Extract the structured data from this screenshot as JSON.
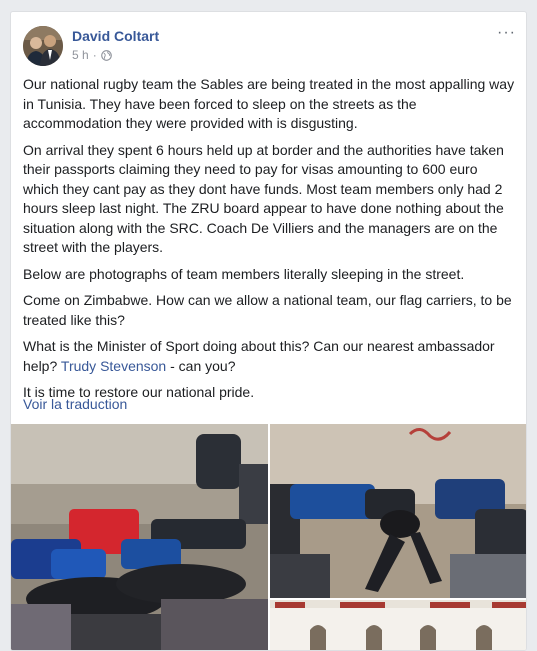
{
  "post": {
    "author": "David Coltart",
    "time": "5 h",
    "dot": "·",
    "more": "···",
    "translate": "Voir la traduction"
  },
  "paragraphs": [
    "Our national rugby team the Sables are being treated in the most appalling way in Tunisia. They have been forced to sleep on the streets as the accommodation they were provided with is disgusting.",
    "On arrival they spent 6 hours held up at border and the authorities have taken their passports claiming they need to pay for visas amounting to 600 euro which they cant pay as they dont have funds. Most team members only had 2 hours sleep last night. The ZRU board appear to have done nothing about the situation along with the SRC. Coach De Villiers and the managers are on the street with the players.",
    "Below are photographs of team members literally sleeping in the street.",
    "Come on Zimbabwe. How can we allow a national team, our flag carriers, to be treated like this?"
  ],
  "question": {
    "before": "What is the Minister of Sport doing about this? Can our nearest ambassador help? ",
    "mention": "Trudy Stevenson",
    "after": " - can you?"
  },
  "closing": "It is time to restore our national pride.",
  "icons": {
    "globe": "globe-icon",
    "more": "more-options-icon"
  }
}
